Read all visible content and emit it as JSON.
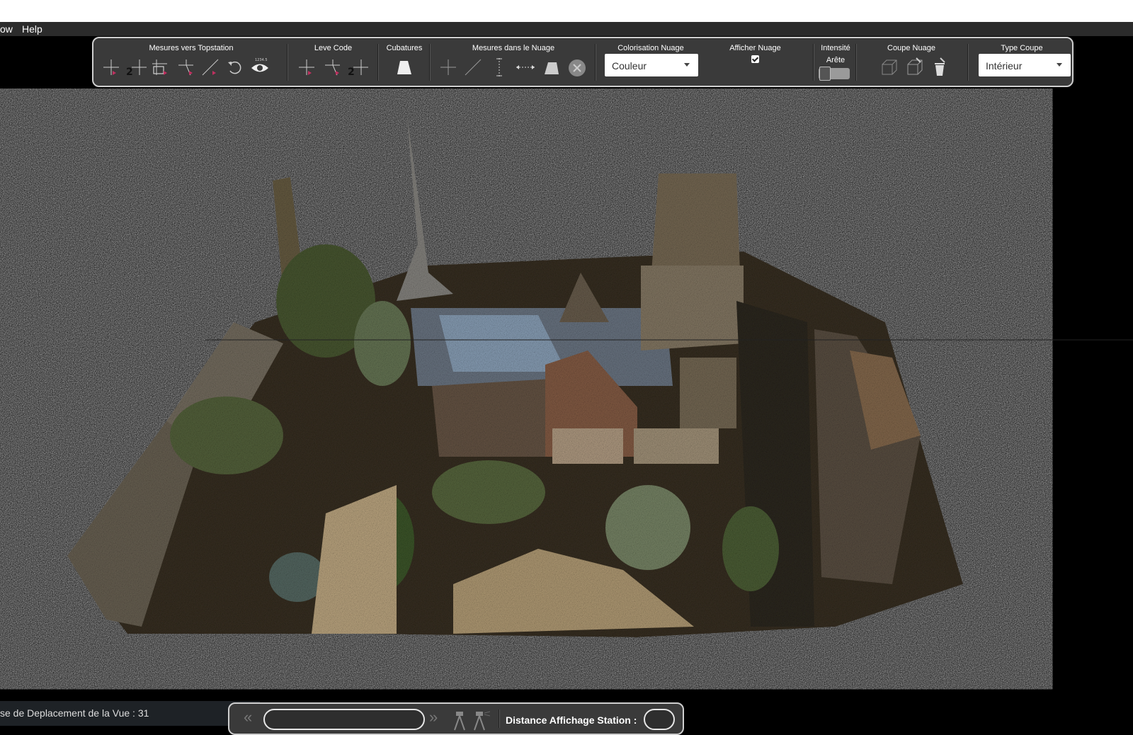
{
  "menu": {
    "items": [
      "ow",
      "Help"
    ]
  },
  "toolbar": {
    "groups": [
      {
        "label": "Mesures vers Topstation"
      },
      {
        "label": "Leve Code"
      },
      {
        "label": "Cubatures"
      },
      {
        "label": "Mesures dans le Nuage"
      },
      {
        "label": "Colorisation Nuage"
      },
      {
        "label": "Afficher Nuage"
      },
      {
        "label": "Intensité"
      },
      {
        "label": "Arête"
      },
      {
        "label": "Coupe Nuage"
      },
      {
        "label": "Type Coupe"
      }
    ],
    "icon_numbers": {
      "n1": "2",
      "n2": "2",
      "small_value": "1234.5"
    },
    "colorisation_value": "Couleur",
    "afficher_nuage_checked": true,
    "arete_toggle_on": false,
    "type_coupe_value": "Intérieur"
  },
  "status": {
    "vitesse_text": "se de Deplacement de la Vue : 31"
  },
  "bottom": {
    "prev_icon": "double-chevron-left",
    "next_icon": "double-chevron-right",
    "station_label": "Distance Affichage Station :",
    "station_value": ""
  },
  "colors": {
    "panel": "#3a3a3a",
    "border": "#cfcfcf",
    "background": "#000000"
  }
}
